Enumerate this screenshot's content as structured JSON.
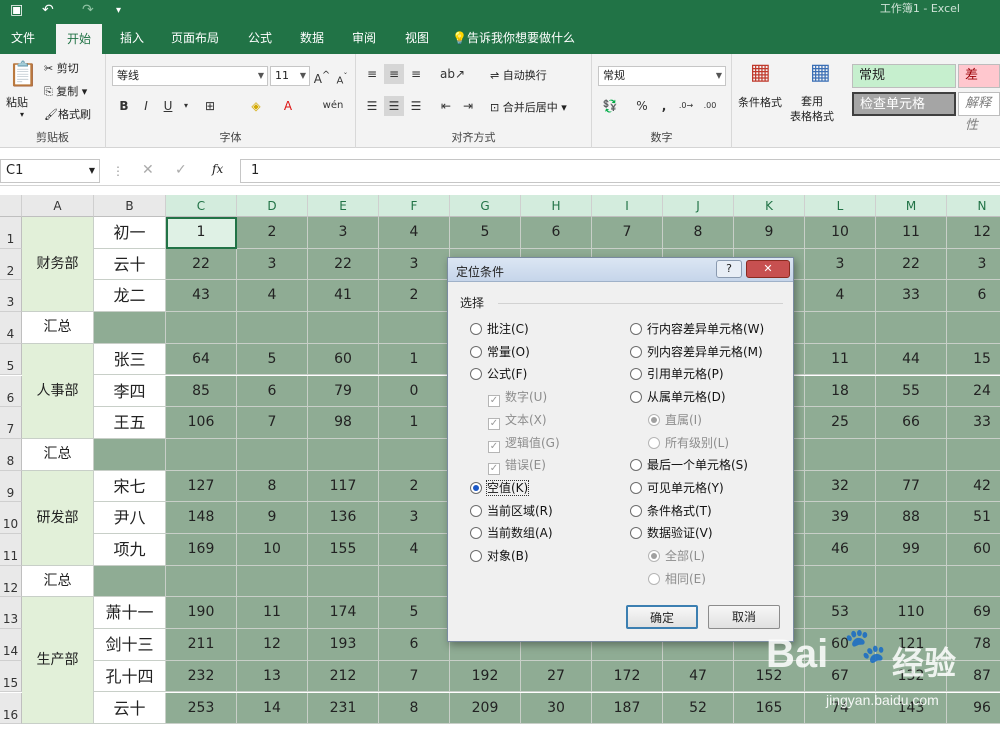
{
  "app": {
    "title": "工作簿1 - Excel"
  },
  "tabs": [
    "文件",
    "开始",
    "插入",
    "页面布局",
    "公式",
    "数据",
    "审阅",
    "视图"
  ],
  "tell_me": "告诉我你想要做什么",
  "ribbon": {
    "clipboard": {
      "paste": "粘贴",
      "cut": "剪切",
      "copy": "复制",
      "format_painter": "格式刷",
      "label": "剪贴板"
    },
    "font": {
      "name": "等线",
      "size": "11",
      "label": "字体",
      "bold": "B",
      "italic": "I",
      "underline": "U",
      "wen": "wén"
    },
    "align": {
      "wrap": "自动换行",
      "merge": "合并后居中",
      "label": "对齐方式"
    },
    "number": {
      "format": "常规",
      "label": "数字",
      "percent": "%",
      "comma": ","
    },
    "styles": {
      "cond": "条件格式",
      "table": "套用\n表格格式",
      "normal": "常规",
      "bad": "差",
      "check": "检查单元格",
      "explain": "解释性"
    }
  },
  "formula": {
    "namebox": "C1",
    "fx": "fx",
    "value": "1"
  },
  "colors": {
    "brand": "#217346",
    "gray_cell": "#8fac94",
    "dept_fill": "#e2f0d9"
  },
  "sheet": {
    "columns": [
      "A",
      "B",
      "C",
      "D",
      "E",
      "F",
      "G",
      "H",
      "I",
      "J",
      "K",
      "L",
      "M",
      "N"
    ],
    "rows": [
      "1",
      "2",
      "3",
      "4",
      "5",
      "6",
      "7",
      "8",
      "9",
      "10",
      "11",
      "12",
      "13",
      "14",
      "15",
      "16"
    ],
    "depts": [
      {
        "name": "财务部",
        "from": 0,
        "to": 2
      },
      {
        "name": "汇总",
        "from": 3,
        "to": 3
      },
      {
        "name": "人事部",
        "from": 4,
        "to": 6
      },
      {
        "name": "汇总",
        "from": 7,
        "to": 7
      },
      {
        "name": "研发部",
        "from": 8,
        "to": 10
      },
      {
        "name": "汇总",
        "from": 11,
        "to": 11
      },
      {
        "name": "生产部",
        "from": 12,
        "to": 15
      }
    ],
    "names": [
      "初一",
      "云十",
      "龙二",
      "",
      "张三",
      "李四",
      "王五",
      "",
      "宋七",
      "尹八",
      "项九",
      "",
      "萧十一",
      "剑十三",
      "孔十四",
      "云十"
    ],
    "values": [
      [
        "1",
        "2",
        "3",
        "4",
        "5",
        "6",
        "7",
        "8",
        "9",
        "10",
        "11",
        "12"
      ],
      [
        "22",
        "3",
        "22",
        "3",
        "",
        "",
        "",
        "",
        "",
        "3",
        "22",
        "3"
      ],
      [
        "43",
        "4",
        "41",
        "2",
        "",
        "",
        "",
        "",
        "",
        "4",
        "33",
        "6"
      ],
      [
        "",
        "",
        "",
        "",
        "",
        "",
        "",
        "",
        "",
        "",
        "",
        ""
      ],
      [
        "64",
        "5",
        "60",
        "1",
        "",
        "",
        "",
        "",
        "",
        "11",
        "44",
        "15"
      ],
      [
        "85",
        "6",
        "79",
        "0",
        "",
        "",
        "",
        "",
        "",
        "18",
        "55",
        "24"
      ],
      [
        "106",
        "7",
        "98",
        "1",
        "",
        "",
        "",
        "",
        "",
        "25",
        "66",
        "33"
      ],
      [
        "",
        "",
        "",
        "",
        "",
        "",
        "",
        "",
        "",
        "",
        "",
        ""
      ],
      [
        "127",
        "8",
        "117",
        "2",
        "",
        "",
        "",
        "",
        "",
        "32",
        "77",
        "42"
      ],
      [
        "148",
        "9",
        "136",
        "3",
        "",
        "",
        "",
        "",
        "",
        "39",
        "88",
        "51"
      ],
      [
        "169",
        "10",
        "155",
        "4",
        "",
        "",
        "",
        "",
        "",
        "46",
        "99",
        "60"
      ],
      [
        "",
        "",
        "",
        "",
        "",
        "",
        "",
        "",
        "",
        "",
        "",
        ""
      ],
      [
        "190",
        "11",
        "174",
        "5",
        "",
        "",
        "",
        "",
        "",
        "53",
        "110",
        "69"
      ],
      [
        "211",
        "12",
        "193",
        "6",
        "",
        "",
        "",
        "",
        "",
        "60",
        "121",
        "78"
      ],
      [
        "232",
        "13",
        "212",
        "7",
        "192",
        "27",
        "172",
        "47",
        "152",
        "67",
        "132",
        "87"
      ],
      [
        "253",
        "14",
        "231",
        "8",
        "209",
        "30",
        "187",
        "52",
        "165",
        "74",
        "143",
        "96"
      ]
    ]
  },
  "dialog": {
    "title": "定位条件",
    "help": "?",
    "close": "✕",
    "section": "选择",
    "left": [
      {
        "label": "批注(C)",
        "type": "radio",
        "on": false,
        "dis": false
      },
      {
        "label": "常量(O)",
        "type": "radio",
        "on": false,
        "dis": false
      },
      {
        "label": "公式(F)",
        "type": "radio",
        "on": false,
        "dis": false
      },
      {
        "label": "数字(U)",
        "type": "check",
        "on": true,
        "dis": true
      },
      {
        "label": "文本(X)",
        "type": "check",
        "on": true,
        "dis": true
      },
      {
        "label": "逻辑值(G)",
        "type": "check",
        "on": true,
        "dis": true
      },
      {
        "label": "错误(E)",
        "type": "check",
        "on": true,
        "dis": true
      },
      {
        "label": "空值(K)",
        "type": "radio",
        "on": true,
        "dis": false
      },
      {
        "label": "当前区域(R)",
        "type": "radio",
        "on": false,
        "dis": false
      },
      {
        "label": "当前数组(A)",
        "type": "radio",
        "on": false,
        "dis": false
      },
      {
        "label": "对象(B)",
        "type": "radio",
        "on": false,
        "dis": false
      }
    ],
    "right": [
      {
        "label": "行内容差异单元格(W)",
        "type": "radio",
        "on": false,
        "dis": false
      },
      {
        "label": "列内容差异单元格(M)",
        "type": "radio",
        "on": false,
        "dis": false
      },
      {
        "label": "引用单元格(P)",
        "type": "radio",
        "on": false,
        "dis": false
      },
      {
        "label": "从属单元格(D)",
        "type": "radio",
        "on": false,
        "dis": false
      },
      {
        "label": "直属(I)",
        "type": "radio",
        "on": true,
        "dis": true
      },
      {
        "label": "所有级别(L)",
        "type": "radio",
        "on": false,
        "dis": true
      },
      {
        "label": "最后一个单元格(S)",
        "type": "radio",
        "on": false,
        "dis": false
      },
      {
        "label": "可见单元格(Y)",
        "type": "radio",
        "on": false,
        "dis": false
      },
      {
        "label": "条件格式(T)",
        "type": "radio",
        "on": false,
        "dis": false
      },
      {
        "label": "数据验证(V)",
        "type": "radio",
        "on": false,
        "dis": false
      },
      {
        "label": "全部(L)",
        "type": "radio",
        "on": true,
        "dis": true
      },
      {
        "label": "相同(E)",
        "type": "radio",
        "on": false,
        "dis": true
      }
    ],
    "ok": "确定",
    "cancel": "取消"
  },
  "watermark": {
    "brand": "Bai",
    "brand2": "经验",
    "url": "jingyan.baidu.com"
  }
}
